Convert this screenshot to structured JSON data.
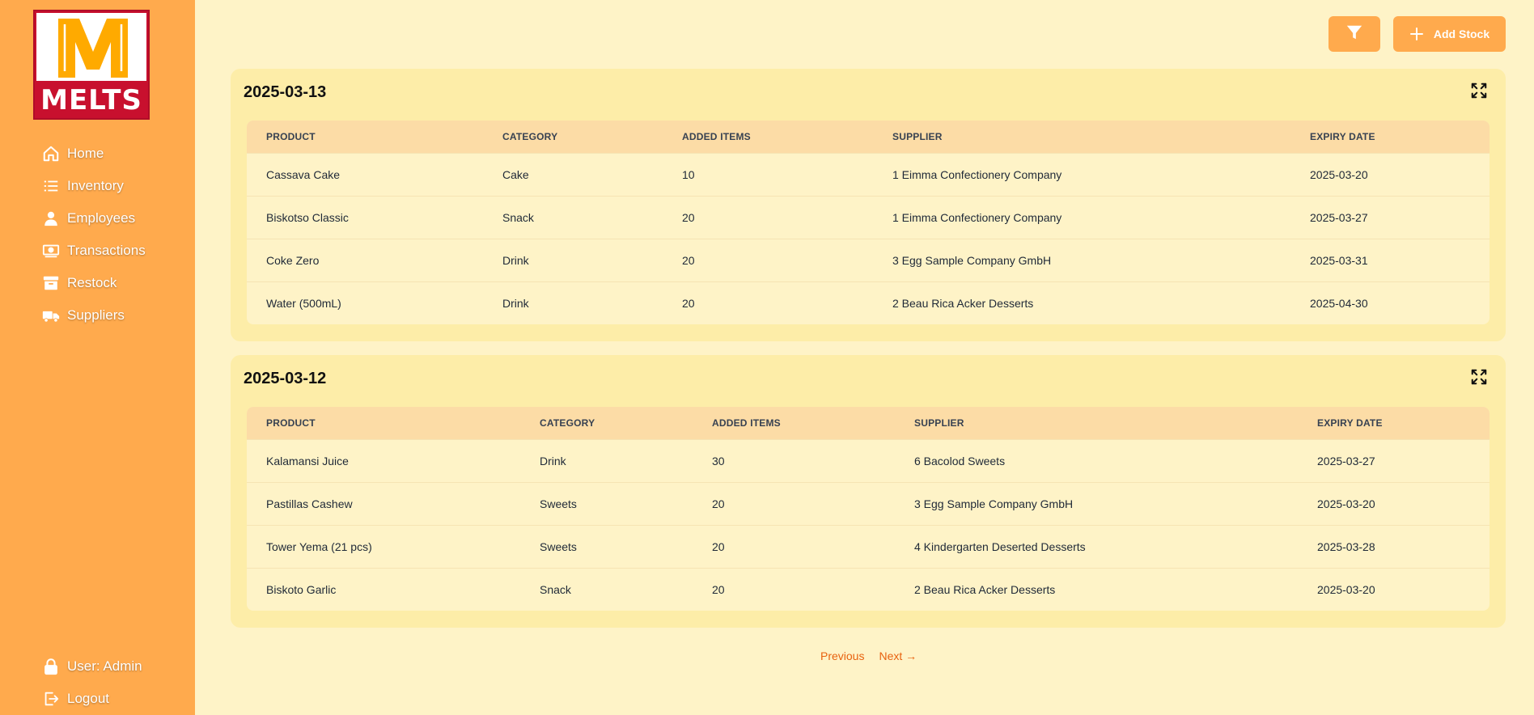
{
  "brand": {
    "logo_text": "MELTS"
  },
  "sidebar": {
    "items": [
      {
        "label": "Home",
        "icon": "home-icon"
      },
      {
        "label": "Inventory",
        "icon": "list-icon"
      },
      {
        "label": "Employees",
        "icon": "user-icon"
      },
      {
        "label": "Transactions",
        "icon": "money-icon"
      },
      {
        "label": "Restock",
        "icon": "archive-icon"
      },
      {
        "label": "Suppliers",
        "icon": "truck-icon"
      }
    ],
    "user_label": "User: Admin",
    "logout_label": "Logout"
  },
  "toolbar": {
    "filter_icon": "filter-icon",
    "add_stock_label": "Add Stock"
  },
  "columns": [
    "PRODUCT",
    "CATEGORY",
    "ADDED ITEMS",
    "SUPPLIER",
    "EXPIRY DATE"
  ],
  "groups": [
    {
      "date": "2025-03-13",
      "rows": [
        [
          "Cassava Cake",
          "Cake",
          "10",
          "1 Eimma Confectionery Company",
          "2025-03-20"
        ],
        [
          "Biskotso Classic",
          "Snack",
          "20",
          "1 Eimma Confectionery Company",
          "2025-03-27"
        ],
        [
          "Coke Zero",
          "Drink",
          "20",
          "3 Egg Sample Company GmbH",
          "2025-03-31"
        ],
        [
          "Water (500mL)",
          "Drink",
          "20",
          "2 Beau Rica Acker Desserts",
          "2025-04-30"
        ]
      ]
    },
    {
      "date": "2025-03-12",
      "rows": [
        [
          "Kalamansi Juice",
          "Drink",
          "30",
          "6 Bacolod Sweets",
          "2025-03-27"
        ],
        [
          "Pastillas Cashew",
          "Sweets",
          "20",
          "3 Egg Sample Company GmbH",
          "2025-03-20"
        ],
        [
          "Tower Yema (21 pcs)",
          "Sweets",
          "20",
          "4 Kindergarten Deserted Desserts",
          "2025-03-28"
        ],
        [
          "Biskoto Garlic",
          "Snack",
          "20",
          "2 Beau Rica Acker Desserts",
          "2025-03-20"
        ]
      ]
    }
  ],
  "pagination": {
    "previous_label": "Previous",
    "next_label": "Next →"
  },
  "colors": {
    "sidebar": "#ffaa4d",
    "background": "#fef3c7",
    "card": "#fdeda8",
    "header_row": "#fcdca6",
    "link": "#e8620f",
    "logo_red": "#c8102e",
    "logo_gold": "#ffaa00"
  }
}
